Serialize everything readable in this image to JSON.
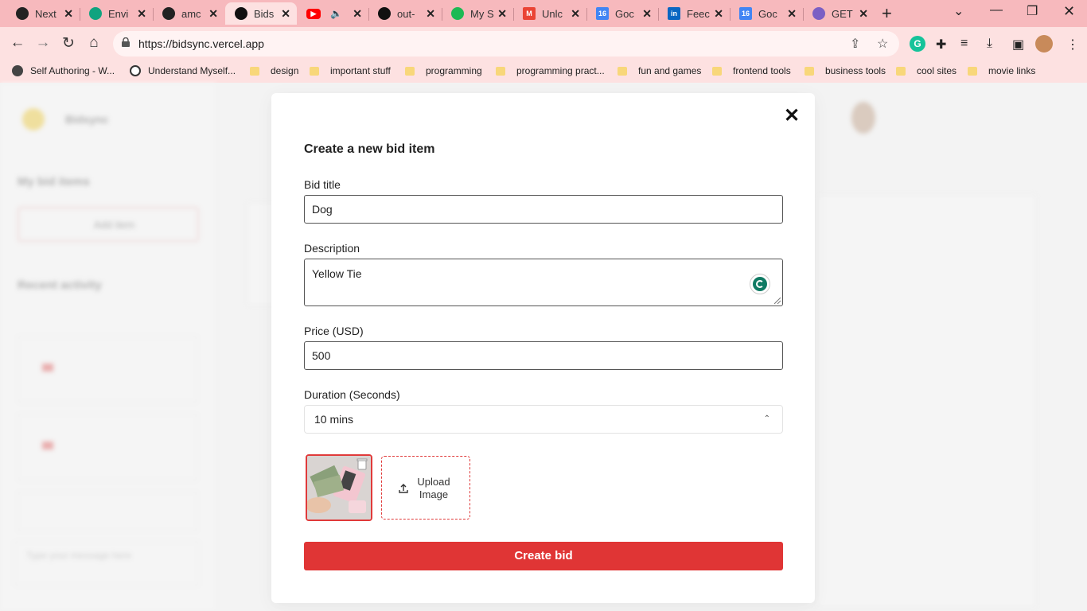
{
  "browser": {
    "tabs": [
      {
        "label": "Next",
        "color": "#222222"
      },
      {
        "label": "Envi",
        "color": "#10a37f"
      },
      {
        "label": "amc",
        "color": "#222222"
      },
      {
        "label": "Bids",
        "color": "#111111",
        "active": true
      },
      {
        "label": "",
        "color": "#ff0000"
      },
      {
        "label": "out-",
        "color": "#111111"
      },
      {
        "label": "My S",
        "color": "#1db954"
      },
      {
        "label": "Unlc",
        "color": "#ea4335"
      },
      {
        "label": "Goc",
        "color": "#4285f4"
      },
      {
        "label": "Feec",
        "color": "#0a66c2"
      },
      {
        "label": "Goc",
        "color": "#4285f4"
      },
      {
        "label": "GET",
        "color": "#7b5fc4"
      }
    ],
    "url": "https://bidsync.vercel.app",
    "bookmarks": [
      {
        "label": "Self Authoring - W...",
        "type": "site"
      },
      {
        "label": "Understand Myself...",
        "type": "site"
      },
      {
        "label": "design",
        "type": "folder"
      },
      {
        "label": "important stuff",
        "type": "folder"
      },
      {
        "label": "programming",
        "type": "folder"
      },
      {
        "label": "programming pract...",
        "type": "folder"
      },
      {
        "label": "fun and games",
        "type": "folder"
      },
      {
        "label": "frontend tools",
        "type": "folder"
      },
      {
        "label": "business tools",
        "type": "folder"
      },
      {
        "label": "cool sites",
        "type": "folder"
      },
      {
        "label": "movie links",
        "type": "folder"
      }
    ]
  },
  "background": {
    "brand": "Bidsync",
    "my_bid_items": "My bid items",
    "add_item": "Add item",
    "recent_activity": "Recent activity",
    "message_placeholder": "Type your message here"
  },
  "modal": {
    "title": "Create a new bid item",
    "close_icon": "close-icon",
    "bid_title_label": "Bid title",
    "bid_title_value": "Dog",
    "description_label": "Description",
    "description_value": "Yellow Tie",
    "price_label": "Price (USD)",
    "price_value": "500",
    "duration_label": "Duration (Seconds)",
    "duration_value": "10 mins",
    "upload_label_1": "Upload",
    "upload_label_2": "Image",
    "submit_label": "Create bid"
  },
  "colors": {
    "accent": "#e03535",
    "chrome_tabbar": "#f7b9bd",
    "chrome_toolbar": "#fde1e1"
  }
}
